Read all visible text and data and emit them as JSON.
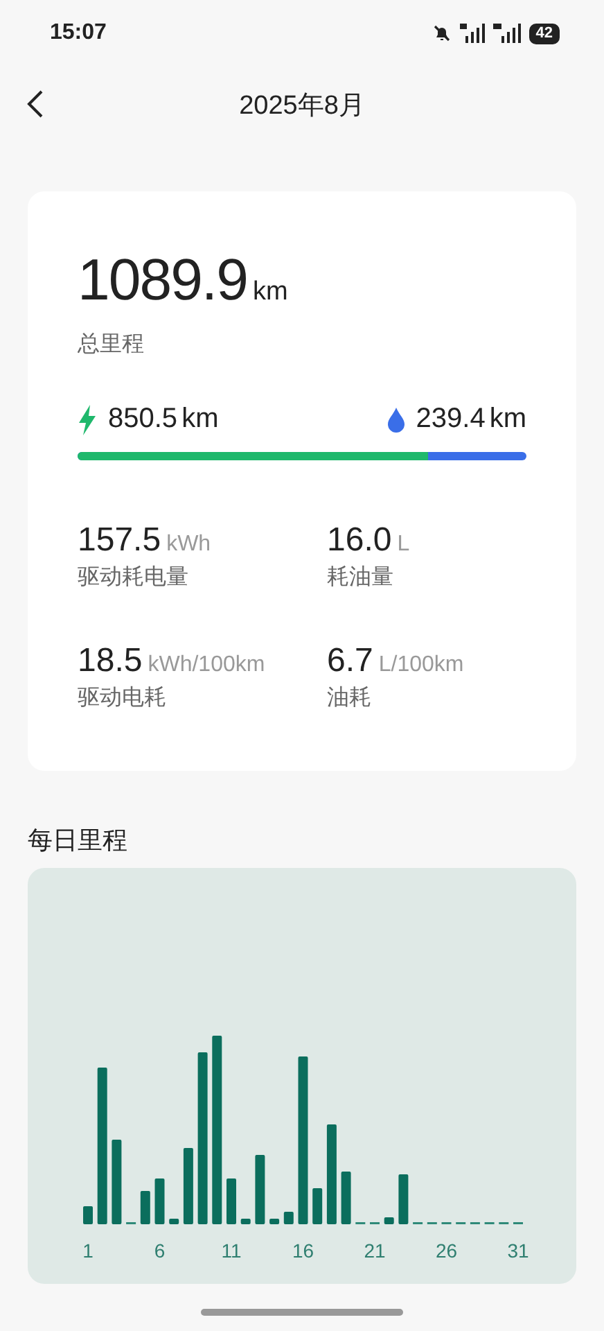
{
  "status_bar": {
    "time": "15:07",
    "battery": "42"
  },
  "header": {
    "title": "2025年8月"
  },
  "summary": {
    "total": {
      "value": "1089.9",
      "unit": "km",
      "label": "总里程"
    },
    "electric": {
      "value": "850.5",
      "unit": "km"
    },
    "fuel": {
      "value": "239.4",
      "unit": "km"
    },
    "split": {
      "level": 0.78
    },
    "stats": [
      {
        "value": "157.5",
        "unit": "kWh",
        "label": "驱动耗电量"
      },
      {
        "value": "16.0",
        "unit": "L",
        "label": "耗油量"
      },
      {
        "value": "18.5",
        "unit": "kWh/100km",
        "label": "驱动电耗"
      },
      {
        "value": "6.7",
        "unit": "L/100km",
        "label": "油耗"
      }
    ]
  },
  "daily": {
    "title": "每日里程",
    "x_labels": [
      "1",
      "6",
      "11",
      "16",
      "21",
      "26",
      "31"
    ]
  }
}
